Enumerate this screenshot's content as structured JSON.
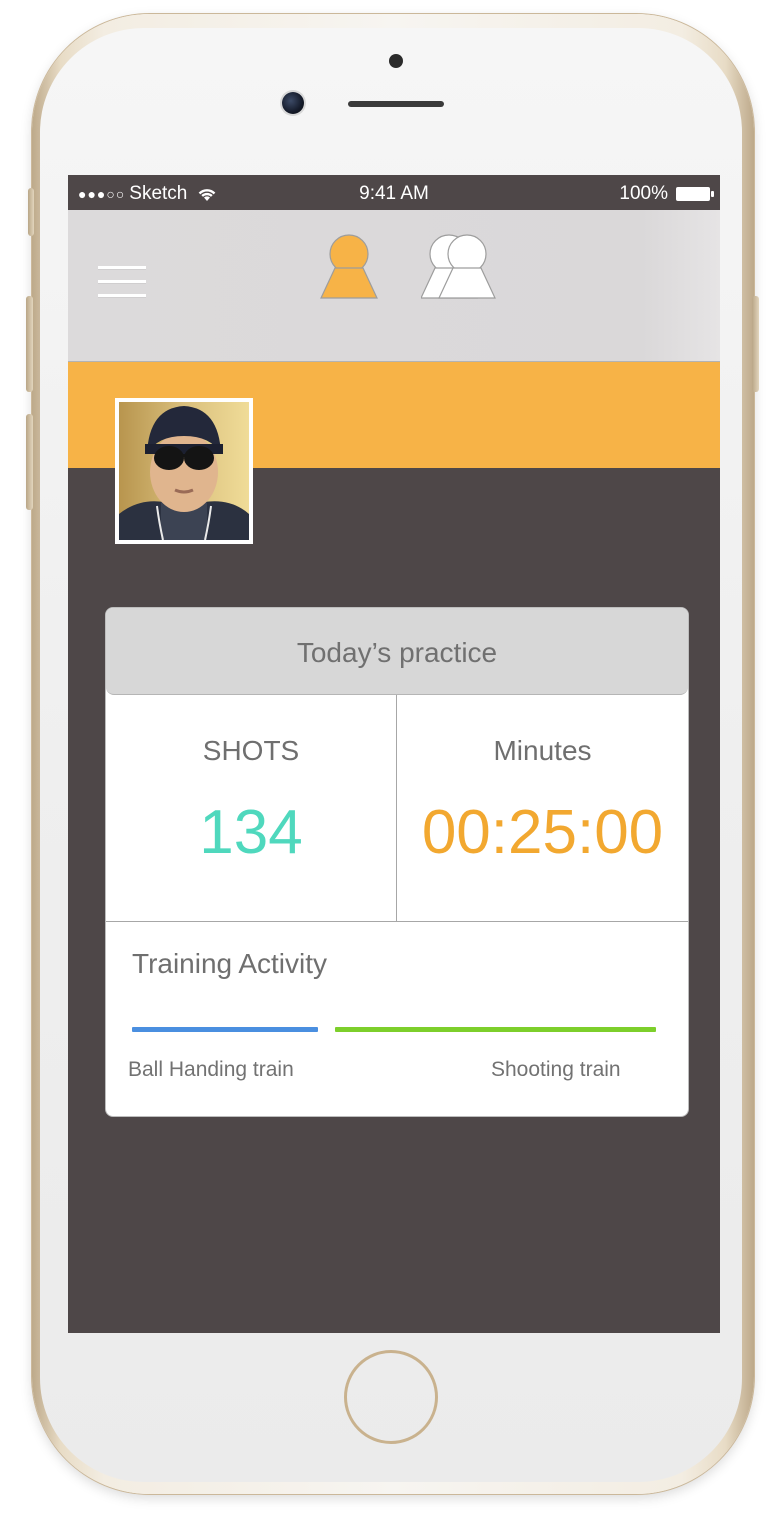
{
  "status_bar": {
    "carrier": "Sketch",
    "signal": "●●●○○",
    "time": "9:41 AM",
    "battery": "100%"
  },
  "nav": {
    "menu_icon": "hamburger-icon",
    "tabs": [
      {
        "icon": "single-person-icon",
        "active": true,
        "color": "#f7b347"
      },
      {
        "icon": "group-people-icon",
        "active": false,
        "color": "#ffffff"
      }
    ]
  },
  "profile": {
    "band_color": "#f7b347",
    "avatar_icon": "user-photo"
  },
  "card": {
    "header": "Today’s practice",
    "shots_label": "SHOTS",
    "shots_value": "134",
    "shots_color": "#4fd8bd",
    "minutes_label": "Minutes",
    "minutes_value": "00:25:00",
    "minutes_color": "#f2a830",
    "activity_title": "Training Activity",
    "activities": [
      {
        "label": "Ball Handing train",
        "color": "#4a8fe0",
        "share": 0.35
      },
      {
        "label": "Shooting train",
        "color": "#7dcf2b",
        "share": 0.65
      }
    ]
  }
}
